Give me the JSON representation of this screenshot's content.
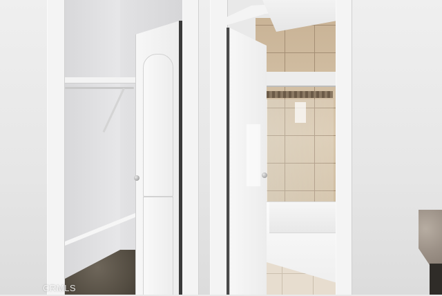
{
  "scene": {
    "watermark": "CRMLS",
    "colors": {
      "wall": "#e9e9e9",
      "door": "#f2f2f2",
      "tile": "#cdb89c",
      "carpet": "#544d42",
      "floor_tile": "#e7ddcf"
    }
  }
}
